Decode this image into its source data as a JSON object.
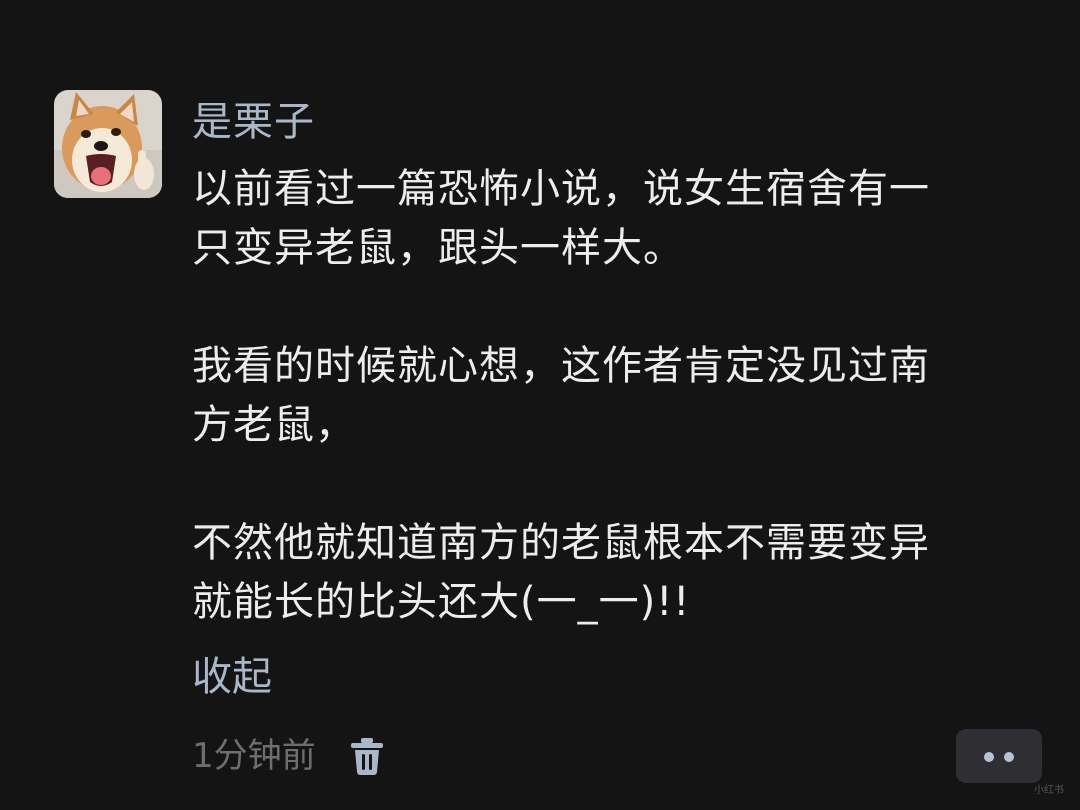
{
  "comment": {
    "username": "是栗子",
    "paragraphs": [
      [
        "以前看过一篇恐怖小说，说女生宿舍有一",
        "只变异老鼠，跟头一样大。"
      ],
      [
        "我看的时候就心想，这作者肯定没见过南",
        "方老鼠，"
      ],
      [
        "不然他就知道南方的老鼠根本不需要变异",
        "就能长的比头还大(一_一)!!"
      ]
    ],
    "collapse_label": "收起",
    "time": "1分钟前"
  },
  "icons": {
    "avatar": "shiba-dog-avatar",
    "delete": "trash-icon",
    "more": "more-dots-icon"
  },
  "colors": {
    "background": "#141414",
    "accent": "#aab7c8",
    "text": "#ededed",
    "muted": "#6e6e6e",
    "button_bg": "#2f2f33"
  },
  "watermark": "小红书"
}
